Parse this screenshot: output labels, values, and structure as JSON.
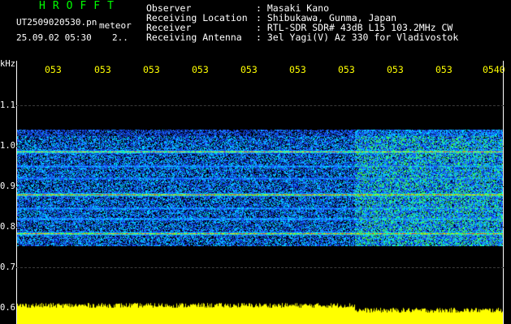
{
  "header": {
    "brand": "HROFFT",
    "filename": "UT2509020530.pn",
    "mode": "meteor",
    "datetime": "25.09.02 05:30",
    "counter": "2..",
    "rows": [
      {
        "label": "Observer",
        "value": ": Masaki Kano"
      },
      {
        "label": "Receiving Location",
        "value": ": Shibukawa, Gunma, Japan"
      },
      {
        "label": "Receiver",
        "value": ": RTL-SDR SDR# 43dB L15 103.2MHz CW"
      },
      {
        "label": "Receiving Antenna",
        "value": ": 3el Yagi(V) Az 330 for Vladivostok"
      }
    ]
  },
  "axis": {
    "unit": "kHz",
    "y_ticks": [
      "1.1",
      "1.0",
      "0.9",
      "0.8",
      "0.7",
      "0.6"
    ],
    "x_ticks": [
      "053",
      "053",
      "053",
      "053",
      "053",
      "053",
      "053",
      "053",
      "053",
      "0540"
    ]
  },
  "colors": {
    "brand": "#00ff00",
    "tick_label": "#ffff00",
    "text": "#ffffff",
    "power": "#ffff00"
  }
}
